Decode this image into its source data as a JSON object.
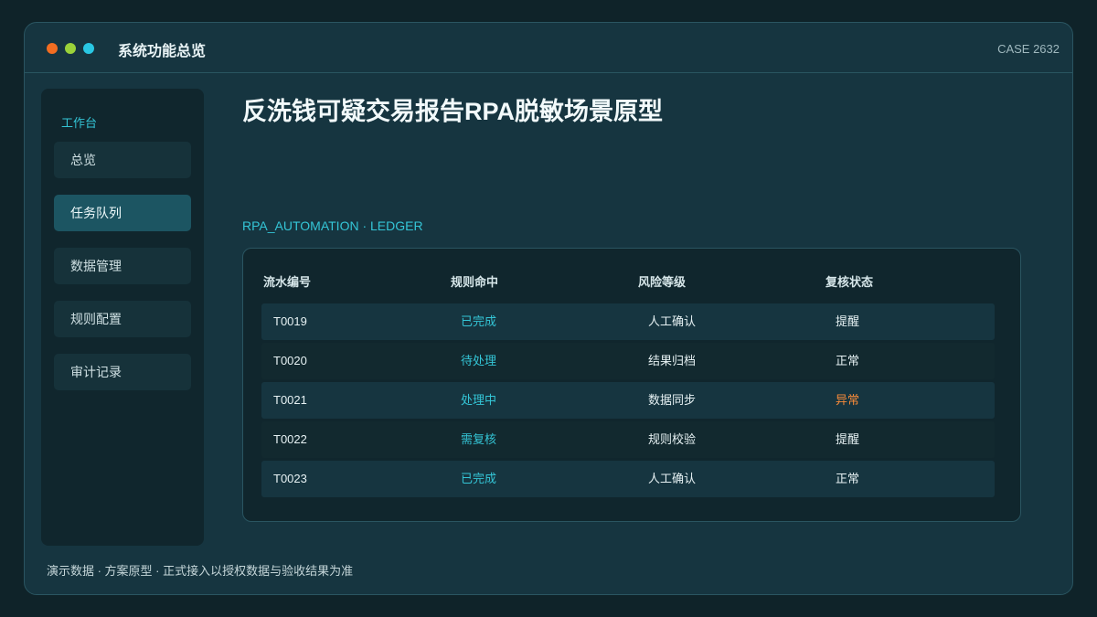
{
  "window": {
    "title": "系统功能总览",
    "case_id": "CASE 2632",
    "dots": [
      "#f26d21",
      "#9ad23a",
      "#29c7e3"
    ]
  },
  "sidebar": {
    "heading": "工作台",
    "items": [
      {
        "label": "总览",
        "active": false
      },
      {
        "label": "任务队列",
        "active": true
      },
      {
        "label": "数据管理",
        "active": false
      },
      {
        "label": "规则配置",
        "active": false
      },
      {
        "label": "审计记录",
        "active": false
      }
    ]
  },
  "main": {
    "title": "反洗钱可疑交易报告RPA脱敏场景原型",
    "section_label": "RPA_AUTOMATION · LEDGER",
    "table": {
      "headers": [
        "流水编号",
        "规则命中",
        "风险等级",
        "复核状态"
      ],
      "rows": [
        [
          "T0019",
          "已完成",
          "人工确认",
          "提醒"
        ],
        [
          "T0020",
          "待处理",
          "结果归档",
          "正常"
        ],
        [
          "T0021",
          "处理中",
          "数据同步",
          "异常"
        ],
        [
          "T0022",
          "需复核",
          "规则校验",
          "提醒"
        ],
        [
          "T0023",
          "已完成",
          "人工确认",
          "正常"
        ]
      ]
    }
  },
  "footer": {
    "note": "演示数据 · 方案原型 · 正式接入以授权数据与验收结果为准"
  },
  "colors": {
    "accent": "#34c5d6",
    "warning": "#f58a3a",
    "background": "#163540"
  }
}
